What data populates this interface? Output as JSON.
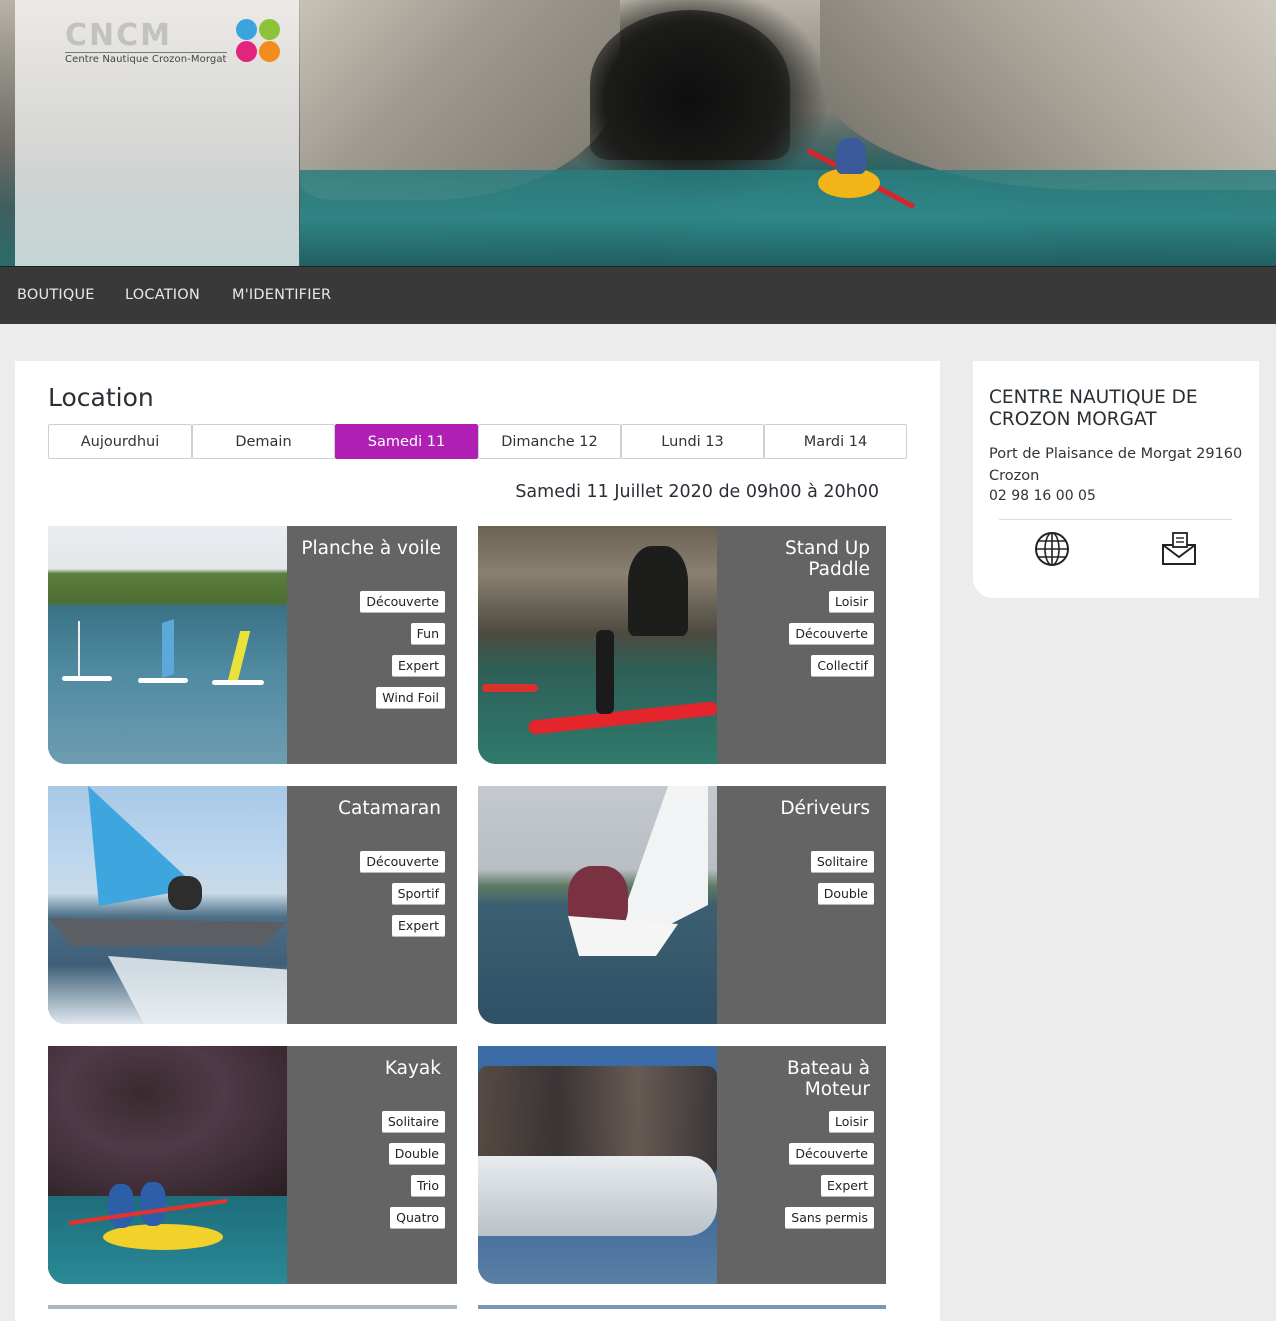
{
  "header": {
    "logo_subtitle": "Centre Nautique Crozon-Morgat",
    "logo_wordmark": "CNCM",
    "icon": "kayak-cave-banner"
  },
  "nav": {
    "items": [
      {
        "label": "BOUTIQUE"
      },
      {
        "label": "LOCATION"
      },
      {
        "label": "M'IDENTIFIER"
      }
    ]
  },
  "main": {
    "title": "Location",
    "tabs": [
      {
        "label": "Aujourdhui",
        "active": false
      },
      {
        "label": "Demain",
        "active": false
      },
      {
        "label": "Samedi 11",
        "active": true
      },
      {
        "label": "Dimanche 12",
        "active": false
      },
      {
        "label": "Lundi 13",
        "active": false
      },
      {
        "label": "Mardi 14",
        "active": false
      }
    ],
    "date_line": "Samedi 11 Juillet 2020 de 09h00 à 20h00",
    "cards": [
      {
        "title": "Planche à voile",
        "options": [
          "Découverte",
          "Fun",
          "Expert",
          "Wind Foil"
        ]
      },
      {
        "title": "Stand Up Paddle",
        "options": [
          "Loisir",
          "Découverte",
          "Collectif"
        ]
      },
      {
        "title": "Catamaran",
        "options": [
          "Découverte",
          "Sportif",
          "Expert"
        ]
      },
      {
        "title": "Dériveurs",
        "options": [
          "Solitaire",
          "Double"
        ]
      },
      {
        "title": "Kayak",
        "options": [
          "Solitaire",
          "Double",
          "Trio",
          "Quatro"
        ]
      },
      {
        "title": "Bateau à Moteur",
        "options": [
          "Loisir",
          "Découverte",
          "Expert",
          "Sans permis"
        ]
      }
    ]
  },
  "sidebar": {
    "title": "CENTRE NAUTIQUE DE CROZON MORGAT",
    "address": "Port de Plaisance de Morgat 29160 Crozon",
    "phone": "02 98 16 00 05",
    "icons": [
      "globe-icon",
      "mail-icon"
    ]
  },
  "colors": {
    "accent": "#b020b4",
    "nav_bg": "#393939",
    "card_bg": "#646464",
    "page_bg": "#ececec"
  }
}
